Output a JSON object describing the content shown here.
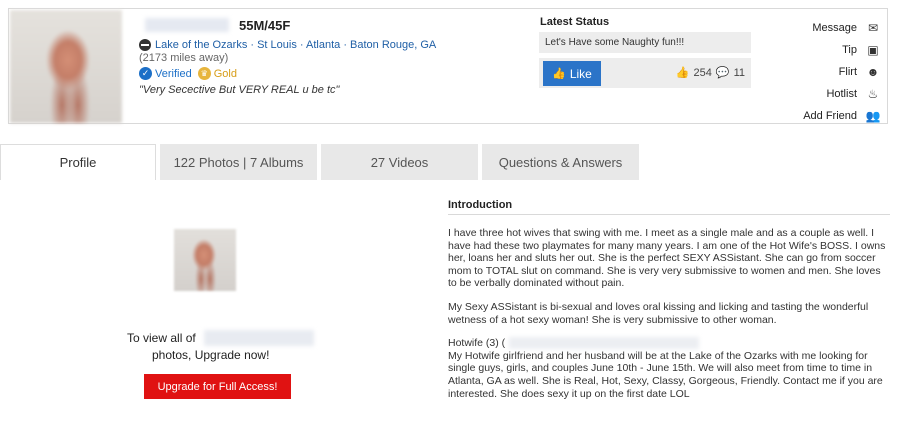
{
  "profile": {
    "sex_age": "55M/45F",
    "locations": "Lake of the Ozarks · St Louis · Atlanta · Baton Rouge, GA",
    "distance": "(2173 miles away)",
    "badges": {
      "verified": "Verified",
      "gold": "Gold"
    },
    "tagline": "\"Very Secective But VERY REAL u be tc\""
  },
  "status": {
    "title": "Latest Status",
    "text": "Let's Have some Naughty fun!!!",
    "like_label": "Like",
    "likes": "254",
    "comments": "11"
  },
  "actions": [
    {
      "label": "Message",
      "icon": "envelope-icon"
    },
    {
      "label": "Tip",
      "icon": "tip-icon"
    },
    {
      "label": "Flirt",
      "icon": "flirt-icon"
    },
    {
      "label": "Hotlist",
      "icon": "flame-icon"
    },
    {
      "label": "Add Friend",
      "icon": "add-friend-icon"
    }
  ],
  "tabs": [
    {
      "label": "Profile",
      "active": true
    },
    {
      "label": "122 Photos | 7 Albums",
      "active": false
    },
    {
      "label": "27 Videos",
      "active": false
    },
    {
      "label": "Questions & Answers",
      "active": false
    }
  ],
  "upgrade": {
    "line1": "To view all of",
    "line2": "photos, Upgrade now!",
    "button": "Upgrade for Full Access!"
  },
  "intro": {
    "title": "Introduction",
    "p1": "I have three hot wives that swing with me. I meet as a single male and as a couple as well. I have had these two playmates for many many years. I am one of the Hot Wife's BOSS. I owns her, loans her and sluts her out. She is the perfect SEXY ASSistant. She can go from soccer mom to TOTAL slut on command. She is very very submissive to women and men. She loves to be verbally dominated without pain.",
    "p2": "My Sexy ASSistant is bi-sexual and loves oral kissing and licking and tasting the wonderful wetness of a hot sexy woman! She is very submissive to other woman.",
    "p3_head": "Hotwife (3) (",
    "p3": "My Hotwife girlfriend and her husband will be at the Lake of the Ozarks with me looking for single guys, girls, and couples June 10th - June 15th. We will also meet from time to time in Atlanta, GA as well. She is Real, Hot, Sexy, Classy, Gorgeous, Friendly. Contact me if you are interested. She does sexy it up on the first date LOL"
  },
  "colors": {
    "accent_blue": "#2b74c8",
    "link_blue": "#1f5fa6",
    "upgrade_red": "#e01212",
    "gold": "#e7b53d"
  }
}
